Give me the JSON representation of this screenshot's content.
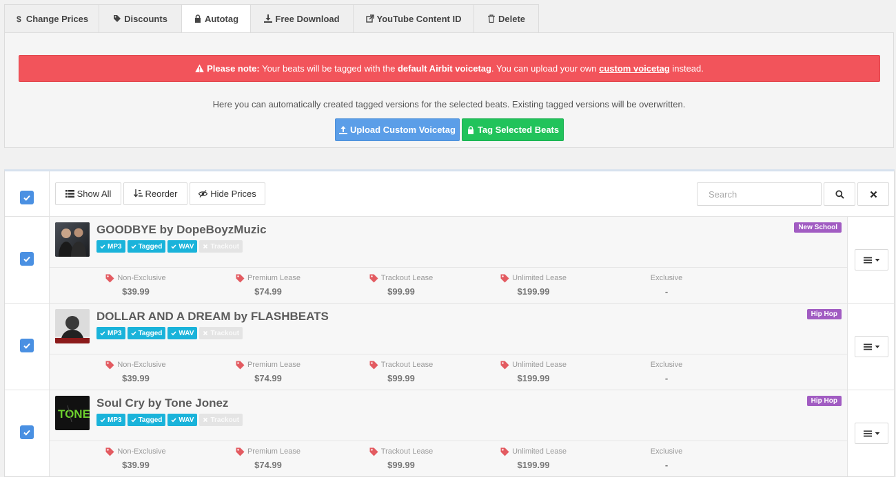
{
  "tabs": [
    {
      "label": "Change Prices",
      "icon": "dollar-icon"
    },
    {
      "label": "Discounts",
      "icon": "tags-icon"
    },
    {
      "label": "Autotag",
      "icon": "lock-icon"
    },
    {
      "label": "Free Download",
      "icon": "download-icon"
    },
    {
      "label": "YouTube Content ID",
      "icon": "external-link-icon"
    },
    {
      "label": "Delete",
      "icon": "trash-icon"
    }
  ],
  "autotag": {
    "alert": {
      "prefix": "Please note:",
      "text1": "Your beats will be tagged with the",
      "bold": "default Airbit voicetag",
      "text2": ". You can upload your own",
      "link": "custom voicetag",
      "text3": "instead."
    },
    "info": "Here you can automatically created tagged versions for the selected beats. Existing tagged versions will be overwritten.",
    "upload_button": "Upload Custom Voicetag",
    "tag_button": "Tag Selected Beats"
  },
  "toolbar": {
    "show_all": "Show All",
    "reorder": "Reorder",
    "hide_prices": "Hide Prices",
    "search_placeholder": "Search"
  },
  "beats": [
    {
      "title": "GOODBYE by DopeBoyzMuzic",
      "genre": "New School",
      "badges": [
        {
          "label": "MP3",
          "on": true
        },
        {
          "label": "Tagged",
          "on": true
        },
        {
          "label": "WAV",
          "on": true
        },
        {
          "label": "Trackout",
          "on": false
        }
      ],
      "prices": [
        {
          "label": "Non-Exclusive",
          "value": "$39.99"
        },
        {
          "label": "Premium Lease",
          "value": "$74.99"
        },
        {
          "label": "Trackout Lease",
          "value": "$99.99"
        },
        {
          "label": "Unlimited Lease",
          "value": "$199.99"
        },
        {
          "label": "Exclusive",
          "value": "-"
        }
      ]
    },
    {
      "title": "DOLLAR AND A DREAM by FLASHBEATS",
      "genre": "Hip Hop",
      "badges": [
        {
          "label": "MP3",
          "on": true
        },
        {
          "label": "Tagged",
          "on": true
        },
        {
          "label": "WAV",
          "on": true
        },
        {
          "label": "Trackout",
          "on": false
        }
      ],
      "prices": [
        {
          "label": "Non-Exclusive",
          "value": "$39.99"
        },
        {
          "label": "Premium Lease",
          "value": "$74.99"
        },
        {
          "label": "Trackout Lease",
          "value": "$99.99"
        },
        {
          "label": "Unlimited Lease",
          "value": "$199.99"
        },
        {
          "label": "Exclusive",
          "value": "-"
        }
      ]
    },
    {
      "title": "Soul Cry by Tone Jonez",
      "genre": "Hip Hop",
      "cover_text": "TONE",
      "badges": [
        {
          "label": "MP3",
          "on": true
        },
        {
          "label": "Tagged",
          "on": true
        },
        {
          "label": "WAV",
          "on": true
        },
        {
          "label": "Trackout",
          "on": false
        }
      ],
      "prices": [
        {
          "label": "Non-Exclusive",
          "value": "$39.99"
        },
        {
          "label": "Premium Lease",
          "value": "$74.99"
        },
        {
          "label": "Trackout Lease",
          "value": "$99.99"
        },
        {
          "label": "Unlimited Lease",
          "value": "$199.99"
        },
        {
          "label": "Exclusive",
          "value": "-"
        }
      ]
    }
  ]
}
